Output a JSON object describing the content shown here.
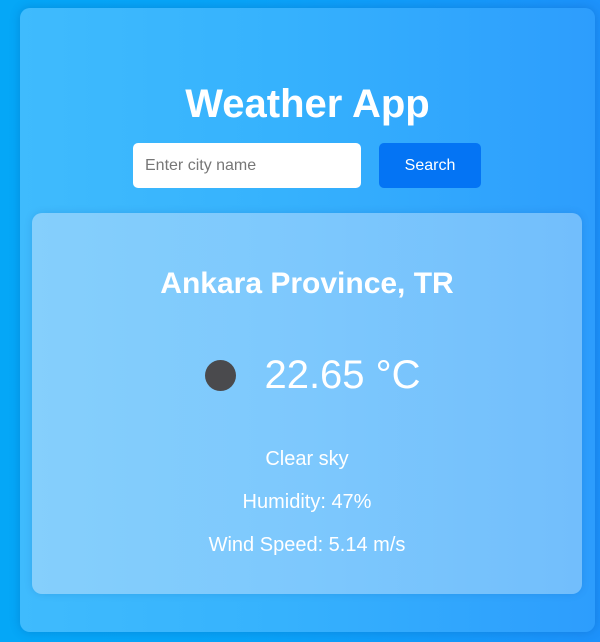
{
  "app": {
    "title": "Weather App"
  },
  "search": {
    "placeholder": "Enter city name",
    "value": "",
    "button_label": "Search"
  },
  "weather": {
    "city": "Ankara Province, TR",
    "icon": "weather-circle-icon",
    "temperature": "22.65 °C",
    "description": "Clear sky",
    "humidity": "Humidity: 47%",
    "wind_speed": "Wind Speed: 5.14 m/s"
  },
  "colors": {
    "background": "#08a4f8",
    "container": "#36b2fd",
    "card": "#7dc8fd",
    "button": "#0474f4",
    "icon": "#4a4a4d",
    "text": "#ffffff"
  }
}
